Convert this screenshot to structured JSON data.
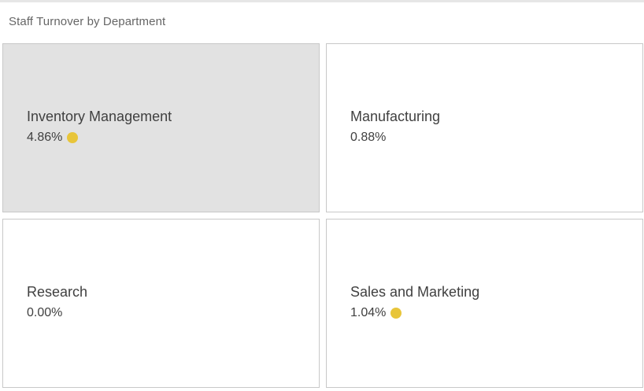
{
  "title": "Staff Turnover by Department",
  "colors": {
    "indicator": "#e8c53a",
    "selected_background": "#e2e2e2",
    "border": "#c8c8c8"
  },
  "cards": [
    {
      "label": "Inventory Management",
      "value": "4.86%",
      "indicator": true,
      "selected": true
    },
    {
      "label": "Manufacturing",
      "value": "0.88%",
      "indicator": false,
      "selected": false
    },
    {
      "label": "Research",
      "value": "0.00%",
      "indicator": false,
      "selected": false
    },
    {
      "label": "Sales and Marketing",
      "value": "1.04%",
      "indicator": true,
      "selected": false
    }
  ]
}
